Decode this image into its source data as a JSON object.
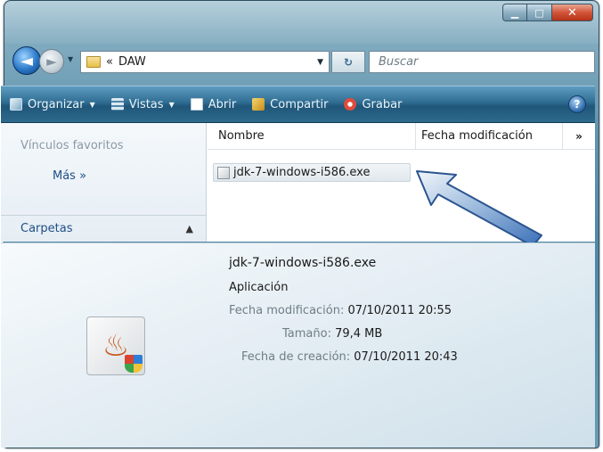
{
  "address": {
    "prefix": "«",
    "folder": "DAW"
  },
  "search": {
    "placeholder": "Buscar"
  },
  "commands": {
    "organizar": "Organizar",
    "vistas": "Vistas",
    "abrir": "Abrir",
    "compartir": "Compartir",
    "grabar": "Grabar"
  },
  "navpane": {
    "favorites_title": "Vínculos favoritos",
    "more_link": "Más  »",
    "folders_label": "Carpetas"
  },
  "columns": {
    "name": "Nombre",
    "date": "Fecha modificación",
    "more": "»"
  },
  "files": [
    {
      "name": "jdk-7-windows-i586.exe"
    }
  ],
  "details": {
    "name": "jdk-7-windows-i586.exe",
    "type": "Aplicación",
    "modified_label": "Fecha modificación:",
    "modified_value": "07/10/2011 20:55",
    "size_label": "Tamaño:",
    "size_value": "79,4 MB",
    "created_label": "Fecha de creación:",
    "created_value": "07/10/2011 20:43"
  },
  "icons": {
    "back": "back-arrow-icon",
    "forward": "forward-arrow-icon",
    "refresh": "refresh-icon",
    "help": "help-icon",
    "java": "java-installer-icon"
  },
  "colors": {
    "command_bar": "#2f6c92",
    "link": "#1f4e86",
    "annotation_arrow": "#3a6fb8"
  }
}
